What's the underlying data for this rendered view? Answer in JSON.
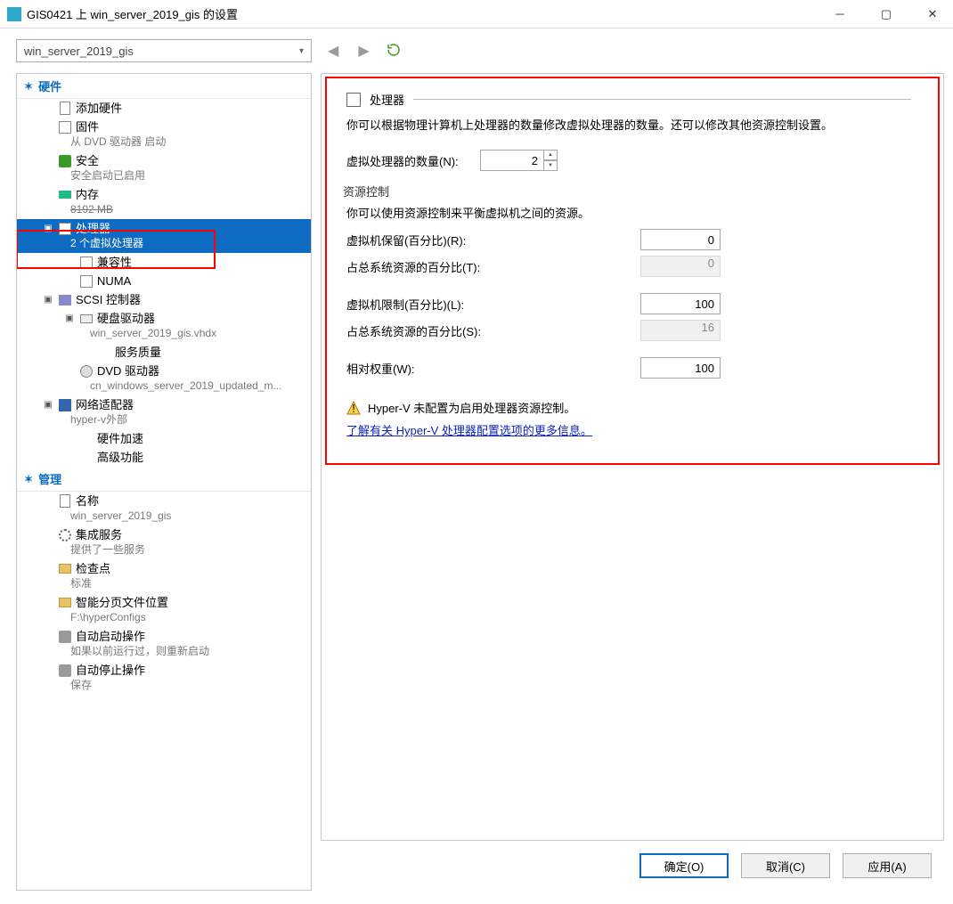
{
  "title": "GIS0421 上 win_server_2019_gis 的设置",
  "combo": "win_server_2019_gis",
  "cats": {
    "hardware": "硬件",
    "management": "管理"
  },
  "tree": {
    "add_hw": "添加硬件",
    "firmware": "固件",
    "firmware_sub": "从 DVD 驱动器 启动",
    "security": "安全",
    "security_sub": "安全启动已启用",
    "memory": "内存",
    "memory_sub": "8192 MB",
    "processor": "处理器",
    "processor_sub": "2 个虚拟处理器",
    "compat": "兼容性",
    "numa": "NUMA",
    "scsi": "SCSI 控制器",
    "hdd": "硬盘驱动器",
    "hdd_sub": "win_server_2019_gis.vhdx",
    "qos": "服务质量",
    "dvd": "DVD 驱动器",
    "dvd_sub": "cn_windows_server_2019_updated_m...",
    "nic": "网络适配器",
    "nic_sub": "hyper-v外部",
    "hwacc": "硬件加速",
    "advfeat": "高级功能",
    "name": "名称",
    "name_sub": "win_server_2019_gis",
    "integ": "集成服务",
    "integ_sub": "提供了一些服务",
    "checkpoint": "检查点",
    "checkpoint_sub": "标准",
    "smartpage": "智能分页文件位置",
    "smartpage_sub": "F:\\hyperConfigs",
    "autostart": "自动启动操作",
    "autostart_sub": "如果以前运行过，则重新启动",
    "autostop": "自动停止操作",
    "autostop_sub": "保存"
  },
  "panel": {
    "title": "处理器",
    "desc": "你可以根据物理计算机上处理器的数量修改虚拟处理器的数量。还可以修改其他资源控制设置。",
    "vp_count_lbl": "虚拟处理器的数量(N):",
    "vp_count": "2",
    "group_title": "资源控制",
    "group_desc": "你可以使用资源控制来平衡虚拟机之间的资源。",
    "reserve_lbl": "虚拟机保留(百分比)(R):",
    "reserve": "0",
    "reserve_pct_lbl": "占总系统资源的百分比(T):",
    "reserve_pct": "0",
    "limit_lbl": "虚拟机限制(百分比)(L):",
    "limit": "100",
    "limit_pct_lbl": "占总系统资源的百分比(S):",
    "limit_pct": "16",
    "weight_lbl": "相对权重(W):",
    "weight": "100",
    "warn": "Hyper-V 未配置为启用处理器资源控制。",
    "link": "了解有关 Hyper-V 处理器配置选项的更多信息。"
  },
  "buttons": {
    "ok": "确定(O)",
    "cancel": "取消(C)",
    "apply": "应用(A)"
  }
}
